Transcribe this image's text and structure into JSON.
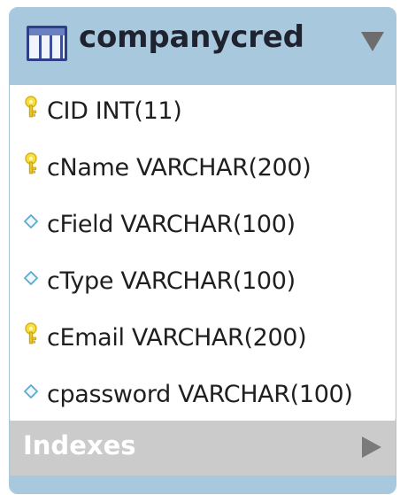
{
  "table": {
    "name": "companycred",
    "header_color": "#a8c9dd",
    "header_icon": "table-icon",
    "toggle_icon": "chevron-down-icon",
    "columns": [
      {
        "label": "CID INT(11)",
        "icon": "primary-key-icon"
      },
      {
        "label": "cName VARCHAR(200)",
        "icon": "primary-key-icon"
      },
      {
        "label": "cField VARCHAR(100)",
        "icon": "column-diamond-icon"
      },
      {
        "label": "cType VARCHAR(100)",
        "icon": "column-diamond-icon"
      },
      {
        "label": "cEmail VARCHAR(200)",
        "icon": "primary-key-icon"
      },
      {
        "label": "cpassword VARCHAR(100)",
        "icon": "column-diamond-icon"
      }
    ],
    "indexes_label": "Indexes",
    "indexes_icon": "chevron-right-icon"
  }
}
